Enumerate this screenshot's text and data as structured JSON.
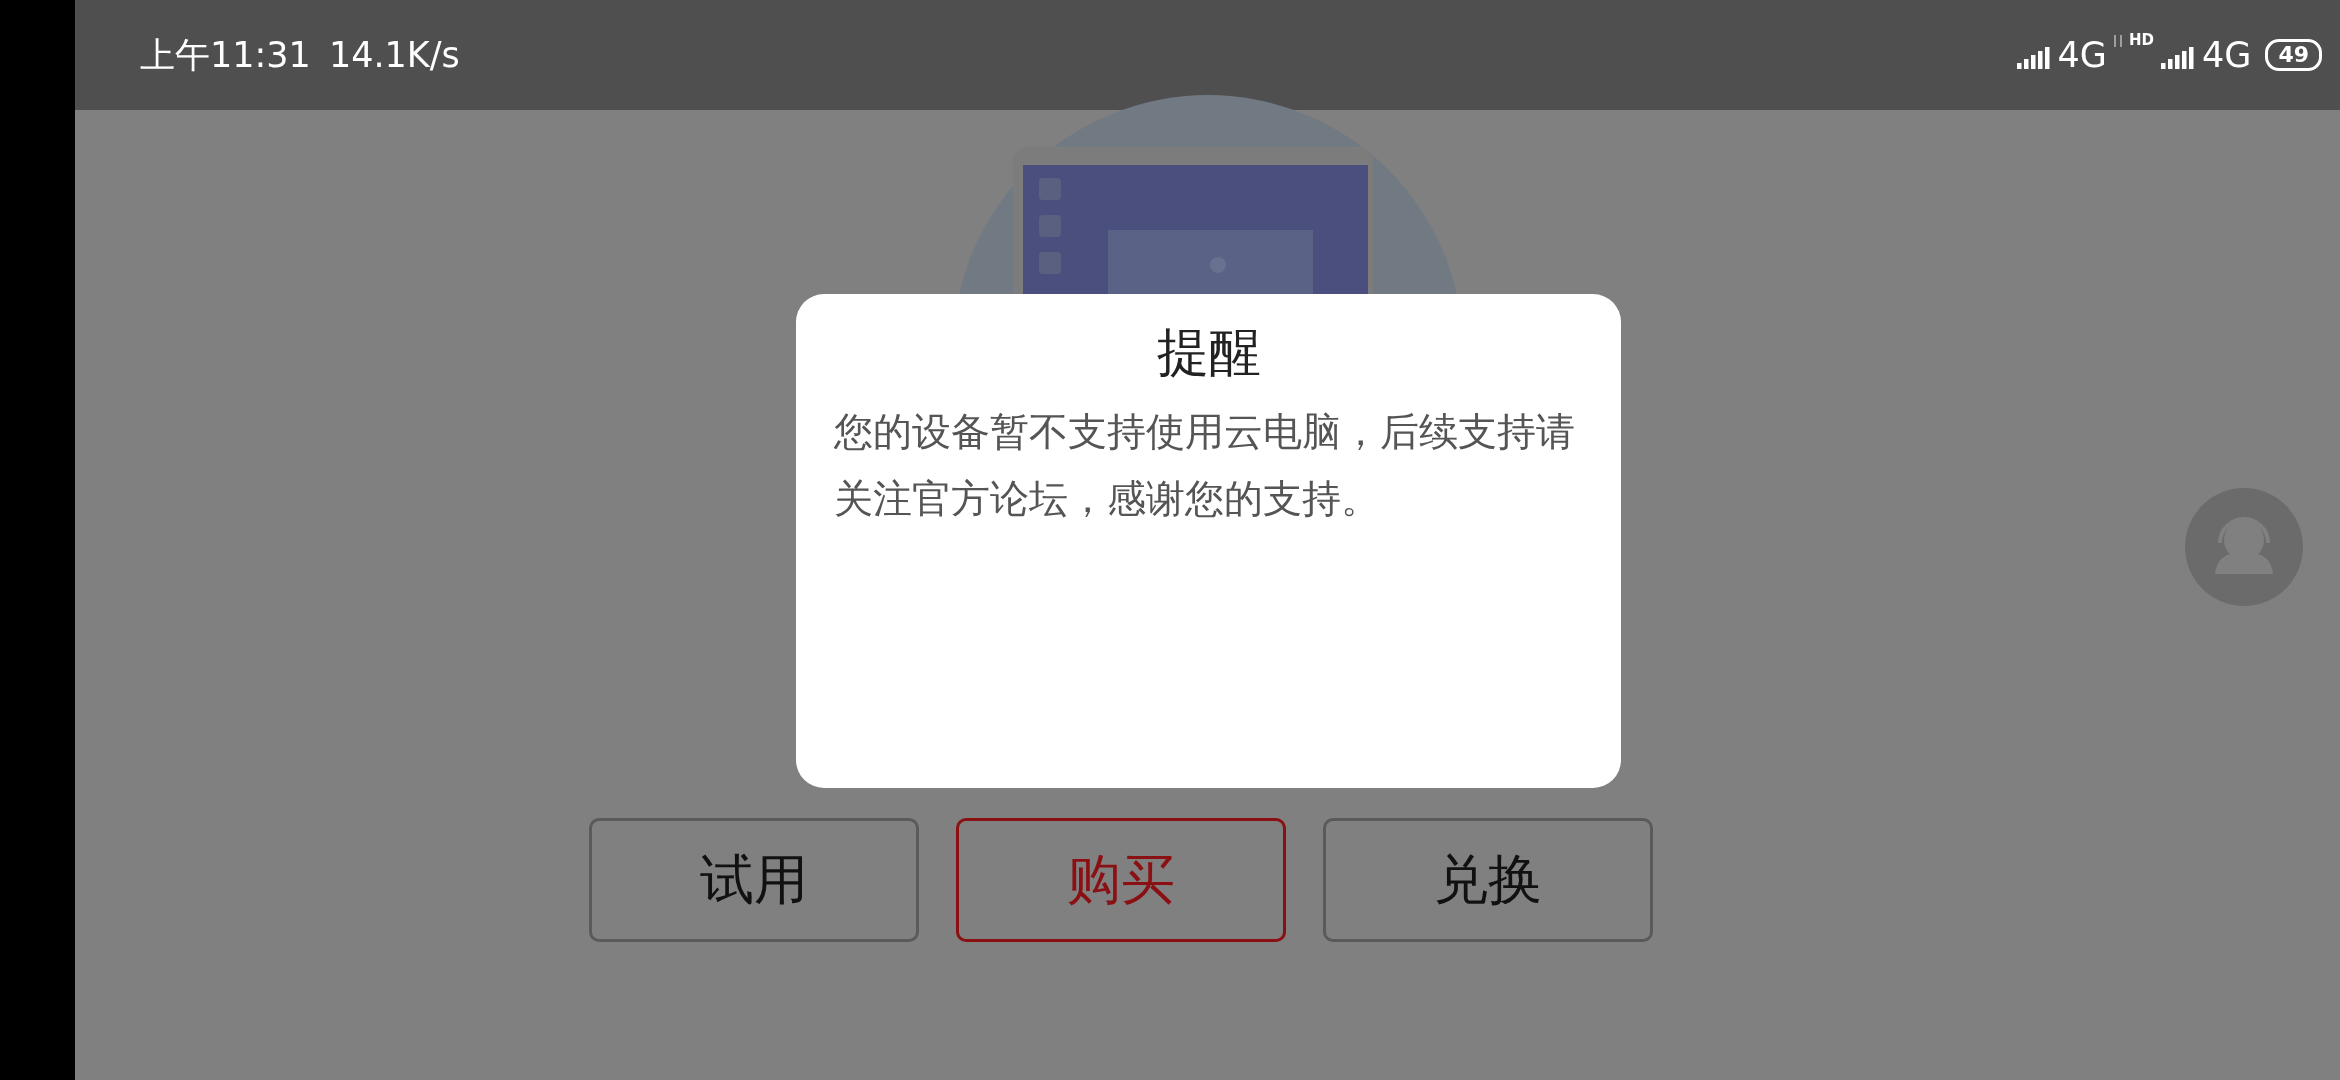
{
  "status_bar": {
    "time": "上午11:31",
    "speed": "14.1K/s",
    "network_1": "4G",
    "hd": "HD",
    "network_2": "4G",
    "battery": "49"
  },
  "buttons": [
    {
      "label": "试用",
      "selected": false
    },
    {
      "label": "购买",
      "selected": true
    },
    {
      "label": "兑换",
      "selected": false
    }
  ],
  "dialog": {
    "title": "提醒",
    "message": "您的设备暂不支持使用云电脑，后续支持请关注官方论坛，感谢您的支持。"
  }
}
